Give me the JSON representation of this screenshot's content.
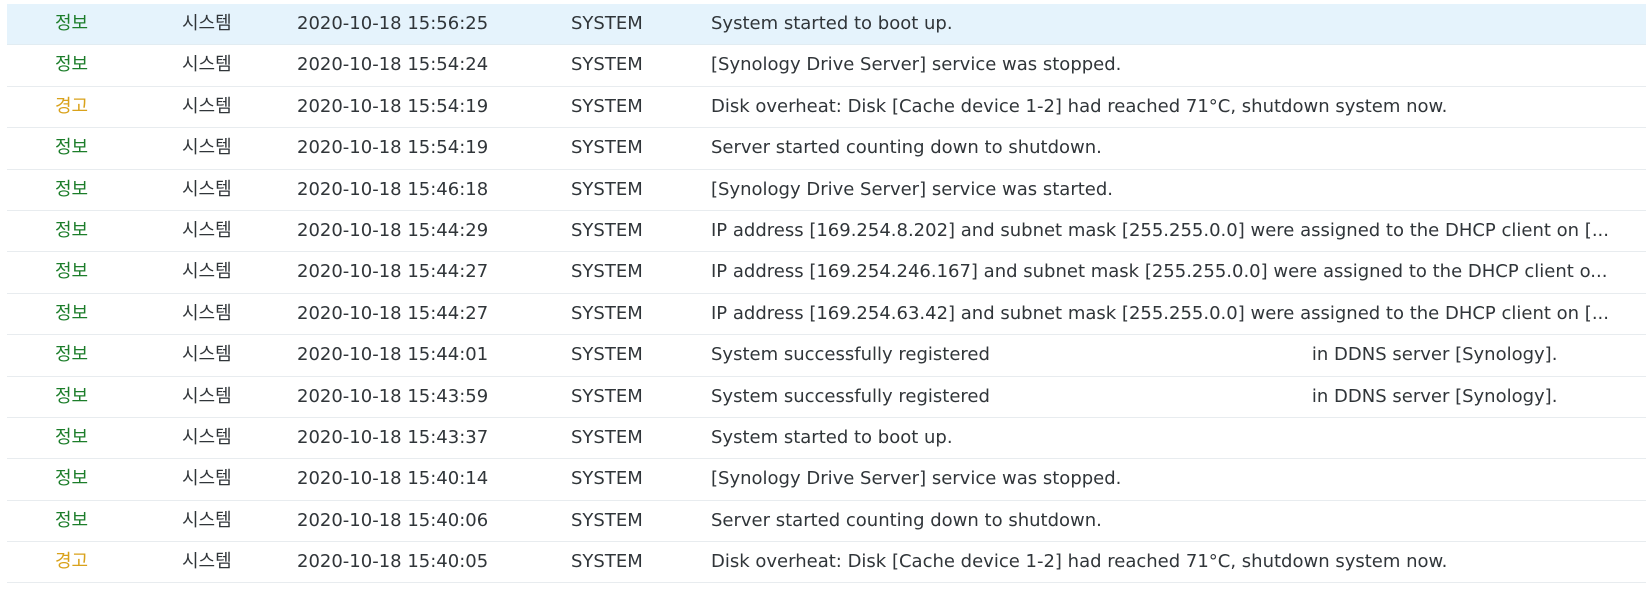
{
  "colors": {
    "info": "#1c7d2a",
    "warning": "#d9a21b",
    "selected_row": "#e5f3fc"
  },
  "logs": [
    {
      "level": "정보",
      "type": "info",
      "category": "시스템",
      "time": "2020-10-18 15:56:25",
      "user": "SYSTEM",
      "event": "System started to boot up.",
      "selected": true
    },
    {
      "level": "정보",
      "type": "info",
      "category": "시스템",
      "time": "2020-10-18 15:54:24",
      "user": "SYSTEM",
      "event": "[Synology Drive Server] service was stopped."
    },
    {
      "level": "경고",
      "type": "warn",
      "category": "시스템",
      "time": "2020-10-18 15:54:19",
      "user": "SYSTEM",
      "event": "Disk overheat: Disk [Cache device 1-2] had reached 71°C, shutdown system now."
    },
    {
      "level": "정보",
      "type": "info",
      "category": "시스템",
      "time": "2020-10-18 15:54:19",
      "user": "SYSTEM",
      "event": "Server started counting down to shutdown."
    },
    {
      "level": "정보",
      "type": "info",
      "category": "시스템",
      "time": "2020-10-18 15:46:18",
      "user": "SYSTEM",
      "event": "[Synology Drive Server] service was started."
    },
    {
      "level": "정보",
      "type": "info",
      "category": "시스템",
      "time": "2020-10-18 15:44:29",
      "user": "SYSTEM",
      "event": "IP address [169.254.8.202] and subnet mask [255.255.0.0] were assigned to the DHCP client on [..."
    },
    {
      "level": "정보",
      "type": "info",
      "category": "시스템",
      "time": "2020-10-18 15:44:27",
      "user": "SYSTEM",
      "event": "IP address [169.254.246.167] and subnet mask [255.255.0.0] were assigned to the DHCP client o..."
    },
    {
      "level": "정보",
      "type": "info",
      "category": "시스템",
      "time": "2020-10-18 15:44:27",
      "user": "SYSTEM",
      "event": "IP address [169.254.63.42] and subnet mask [255.255.0.0] were assigned to the DHCP client on [..."
    },
    {
      "level": "정보",
      "type": "info",
      "category": "시스템",
      "time": "2020-10-18 15:44:01",
      "user": "SYSTEM",
      "event": "System successfully registered",
      "event_tail": "in DDNS server [Synology]."
    },
    {
      "level": "정보",
      "type": "info",
      "category": "시스템",
      "time": "2020-10-18 15:43:59",
      "user": "SYSTEM",
      "event": "System successfully registered",
      "event_tail": "in DDNS server [Synology]."
    },
    {
      "level": "정보",
      "type": "info",
      "category": "시스템",
      "time": "2020-10-18 15:43:37",
      "user": "SYSTEM",
      "event": "System started to boot up."
    },
    {
      "level": "정보",
      "type": "info",
      "category": "시스템",
      "time": "2020-10-18 15:40:14",
      "user": "SYSTEM",
      "event": "[Synology Drive Server] service was stopped."
    },
    {
      "level": "정보",
      "type": "info",
      "category": "시스템",
      "time": "2020-10-18 15:40:06",
      "user": "SYSTEM",
      "event": "Server started counting down to shutdown."
    },
    {
      "level": "경고",
      "type": "warn",
      "category": "시스템",
      "time": "2020-10-18 15:40:05",
      "user": "SYSTEM",
      "event": "Disk overheat: Disk [Cache device 1-2] had reached 71°C, shutdown system now."
    }
  ]
}
